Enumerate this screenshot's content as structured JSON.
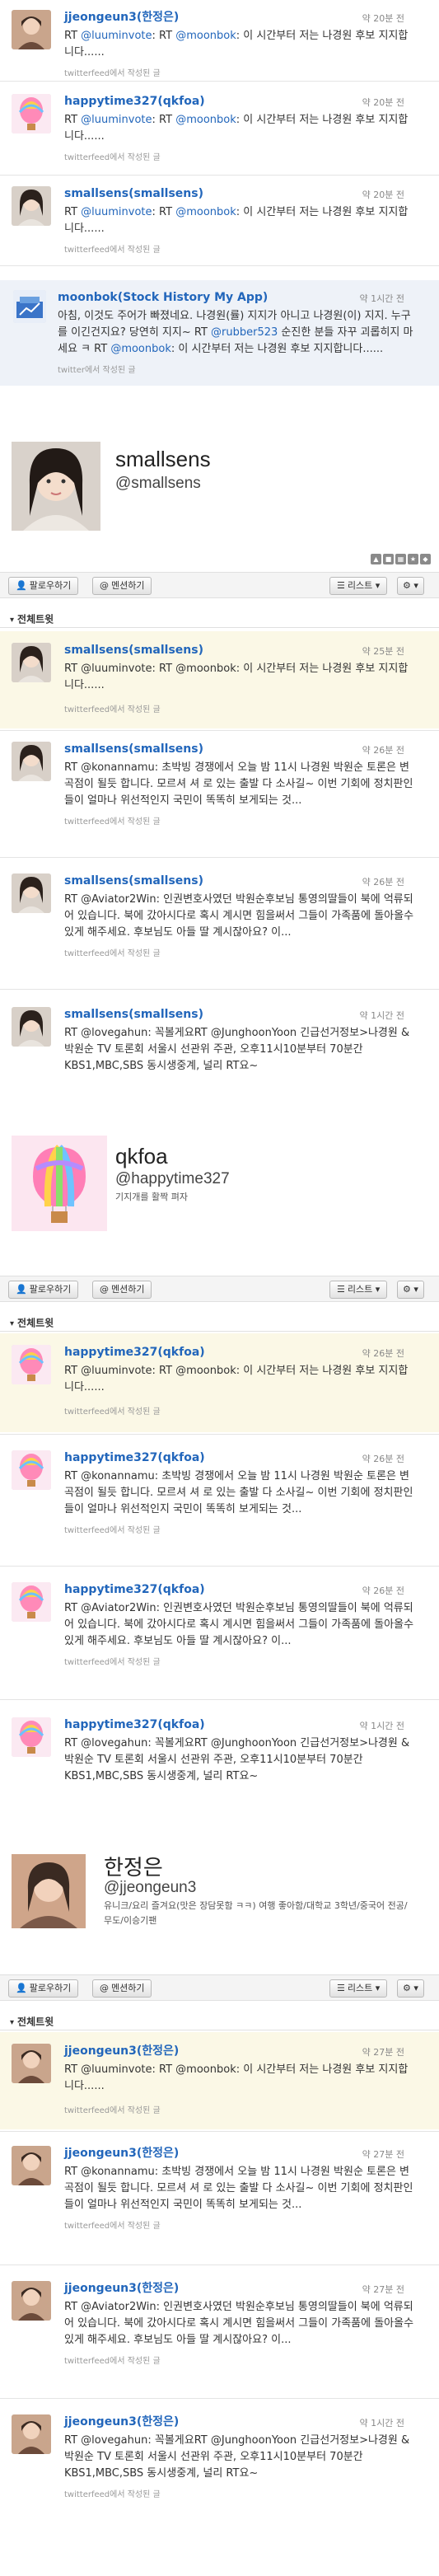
{
  "via_text": "twitterfeed에서 작성된 글",
  "top_tweets": [
    {
      "name": "jjeongeun3(한정은)",
      "time": "약 20분 전",
      "text_prefix": "RT ",
      "h1": "@luuminvote",
      "mid": ": RT ",
      "h2": "@moonbok",
      "text_suffix": ": 이 시간부터 저는 나경원 후보 지지합니다......"
    },
    {
      "name": "happytime327(qkfoa)",
      "time": "약 20분 전",
      "text_prefix": "RT ",
      "h1": "@luuminvote",
      "mid": ": RT ",
      "h2": "@moonbok",
      "text_suffix": ": 이 시간부터 저는 나경원 후보 지지합니다......"
    },
    {
      "name": "smallsens(smallsens)",
      "time": "약 20분 전",
      "text_prefix": "RT ",
      "h1": "@luuminvote",
      "mid": ": RT ",
      "h2": "@moonbok",
      "text_suffix": ": 이 시간부터 저는 나경원 후보 지지합니다......"
    }
  ],
  "moonbok_tweet": {
    "name": "moonbok(Stock History My App)",
    "time": "약 1시간 전",
    "text_a": "아침, 이것도 주어가 빠졌네요. 나경원(률) 지지가 아니고 나경원(이) 지지. 누구를 이긴건지요? 당연히 지지~ RT ",
    "h1": "@rubber523",
    "text_b": " 순진한 분들 자꾸 괴롭히지 마세요 ㅋ RT ",
    "h2": "@moonbok",
    "text_c": ": 이 시간부터 저는 나경원 후보 지지합니다......",
    "via": "twitter에서 작성된 글"
  },
  "profiles": [
    {
      "name": "smallsens",
      "handle": "@smallsens",
      "bio": "",
      "follow_label": "팔로우하기",
      "mention_label": "멘션하기",
      "list_label": "리스트",
      "section_label": "전체트윗",
      "tweets": [
        {
          "name": "smallsens(smallsens)",
          "time": "약 25분 전",
          "text": "RT @luuminvote: RT @moonbok: 이 시간부터 저는 나경원 후보 지지합니다......"
        },
        {
          "name": "smallsens(smallsens)",
          "time": "약 26분 전",
          "text": "RT @konannamu: 초박빙 경쟁에서 오늘 밤 11시 나경원 박원순 토론은 변곡점이 될듯 합니다. 모르셔 셔 로 있는 출발 다 소사길~ 이번 기회에 정치판인들이 얼마나 위선적인지 국민이 똑똑히 보게되는 것..."
        },
        {
          "name": "smallsens(smallsens)",
          "time": "약 26분 전",
          "text": "RT @Aviator2Win: 인권변호사였던 박원순후보님 통영의딸들이 북에 억류되어 있습니다. 북에 갔아시다로 혹시 계시면 힘을써서 그들이 가족품에 돌아올수 있게 해주세요. 후보님도 아들 딸 계시잖아요? 이..."
        },
        {
          "name": "smallsens(smallsens)",
          "time": "약 1시간 전",
          "text": "RT @lovegahun: 꼭볼게요RT @JunghoonYoon 긴급선거정보>나경원 & 박원순 TV 토론회 서울시 선관위 주관, 오후11시10분부터 70분간 KBS1,MBC,SBS 동시생중계, 널리 RT요~"
        }
      ]
    },
    {
      "name": "qkfoa",
      "handle": "@happytime327",
      "bio": "기지개를 활짝 펴자",
      "follow_label": "팔로우하기",
      "mention_label": "멘션하기",
      "list_label": "리스트",
      "section_label": "전체트윗",
      "tweets": [
        {
          "name": "happytime327(qkfoa)",
          "time": "약 26분 전",
          "text": "RT @luuminvote: RT @moonbok: 이 시간부터 저는 나경원 후보 지지합니다......"
        },
        {
          "name": "happytime327(qkfoa)",
          "time": "약 26분 전",
          "text": "RT @konannamu: 초박빙 경쟁에서 오늘 밤 11시 나경원 박원순 토론은 변곡점이 될듯 합니다. 모르셔 셔 로 있는 출발 다 소사길~ 이번 기회에 정치판인들이 얼마나 위선적인지 국민이 똑똑히 보게되는 것..."
        },
        {
          "name": "happytime327(qkfoa)",
          "time": "약 26분 전",
          "text": "RT @Aviator2Win: 인권변호사였던 박원순후보님 통영의딸들이 북에 억류되어 있습니다. 북에 갔아시다로 혹시 계시면 힘을써서 그들이 가족품에 돌아올수 있게 해주세요. 후보님도 아들 딸 계시잖아요? 이..."
        },
        {
          "name": "happytime327(qkfoa)",
          "time": "약 1시간 전",
          "text": "RT @lovegahun: 꼭볼게요RT @JunghoonYoon 긴급선거정보>나경원 & 박원순 TV 토론회 서울시 선관위 주관, 오후11시10분부터 70분간 KBS1,MBC,SBS 동시생중계, 널리 RT요~"
        }
      ]
    },
    {
      "name": "한정은",
      "handle": "@jjeongeun3",
      "bio": "유니크/요리 즐겨요(맛은 장담못함 ㅋㅋ) 여행 좋아함/대학교 3학년/중국어 전공/무도/이승기팬",
      "follow_label": "팔로우하기",
      "mention_label": "멘션하기",
      "list_label": "리스트",
      "section_label": "전체트윗",
      "tweets": [
        {
          "name": "jjeongeun3(한정은)",
          "time": "약 27분 전",
          "text": "RT @luuminvote: RT @moonbok: 이 시간부터 저는 나경원 후보 지지합니다......"
        },
        {
          "name": "jjeongeun3(한정은)",
          "time": "약 27분 전",
          "text": "RT @konannamu: 초박빙 경쟁에서 오늘 밤 11시 나경원 박원순 토론은 변곡점이 될듯 합니다. 모르셔 셔 로 있는 출발 다 소사길~ 이번 기회에 정치판인들이 얼마나 위선적인지 국민이 똑똑히 보게되는 것..."
        },
        {
          "name": "jjeongeun3(한정은)",
          "time": "약 27분 전",
          "text": "RT @Aviator2Win: 인권변호사였던 박원순후보님 통영의딸들이 북에 억류되어 있습니다. 북에 갔아시다로 혹시 계시면 힘을써서 그들이 가족품에 돌아올수 있게 해주세요. 후보님도 아들 딸 계시잖아요? 이..."
        },
        {
          "name": "jjeongeun3(한정은)",
          "time": "약 1시간 전",
          "text": "RT @lovegahun: 꼭볼게요RT @JunghoonYoon 긴급선거정보>나경원 & 박원순 TV 토론회 서울시 선관위 주관, 오후11시10분부터 70분간 KBS1,MBC,SBS 동시생중계, 널리 RT요~"
        }
      ]
    }
  ]
}
